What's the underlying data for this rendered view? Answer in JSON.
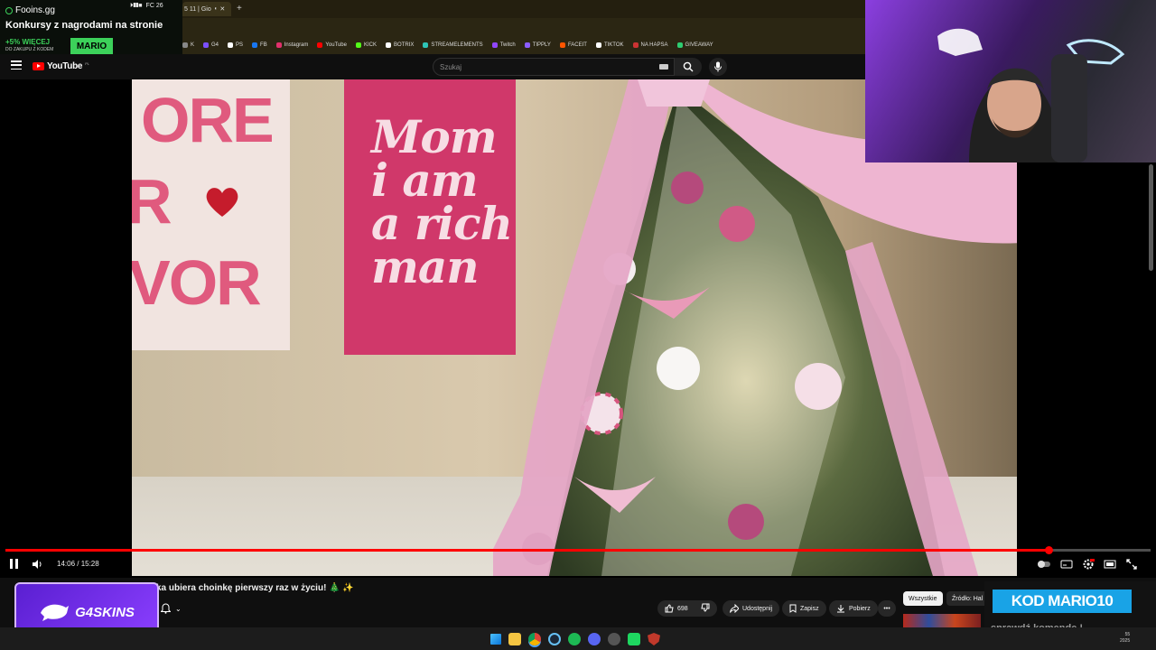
{
  "browser": {
    "tab_label": "5 11 | Gio",
    "bookmarks": [
      "K",
      "G4",
      "PS",
      "FB",
      "Instagram",
      "YouTube",
      "KICK",
      "BOTRIX",
      "STREAMELEMENTS",
      "Twitch",
      "TIPPLY",
      "FACEIT",
      "TIKTOK",
      "NA HAPSA",
      "GIVEAWAY"
    ],
    "fc_label": "FC 26"
  },
  "promo": {
    "site": "Fooins.gg",
    "title": "Konkursy z nagrodami na stronie",
    "bonus": "+5% WIĘCEJ",
    "bonus_sub": "DO ZAKUPU Z KODEM",
    "code": "MARIO"
  },
  "youtube": {
    "logo_text": "YouTube",
    "region": "PL",
    "search_placeholder": "Szukaj",
    "video_title": "ka ubiera choinkę pierwszy raz w życiu! 🎄 ✨",
    "time_current": "14:06",
    "time_total": "15:28",
    "time_display": "14:06 / 15:28",
    "progress": 0.911,
    "likes": "698",
    "share_label": "Udostępnij",
    "save_label": "Zapisz",
    "download_label": "Pobierz",
    "chip_all": "Wszystkie",
    "chip_source": "Źródło: Hal"
  },
  "video_scene": {
    "sign1_text": [
      "ORE",
      "R",
      "VOR"
    ],
    "sign2_text": [
      "Mom",
      "i am",
      "a rich",
      "man"
    ]
  },
  "overlays": {
    "g4skins": "G4SKINS",
    "kod": "KOD MARIO10",
    "kod_sub": "sprawdź komendę !"
  },
  "taskbar": {
    "clock_time": "55",
    "clock_date": "2025"
  },
  "colors": {
    "accent_red": "#ff0000",
    "promo_green": "#3cd15a",
    "kod_blue": "#19a3e6",
    "g4_purple": "#6a2ce0"
  }
}
